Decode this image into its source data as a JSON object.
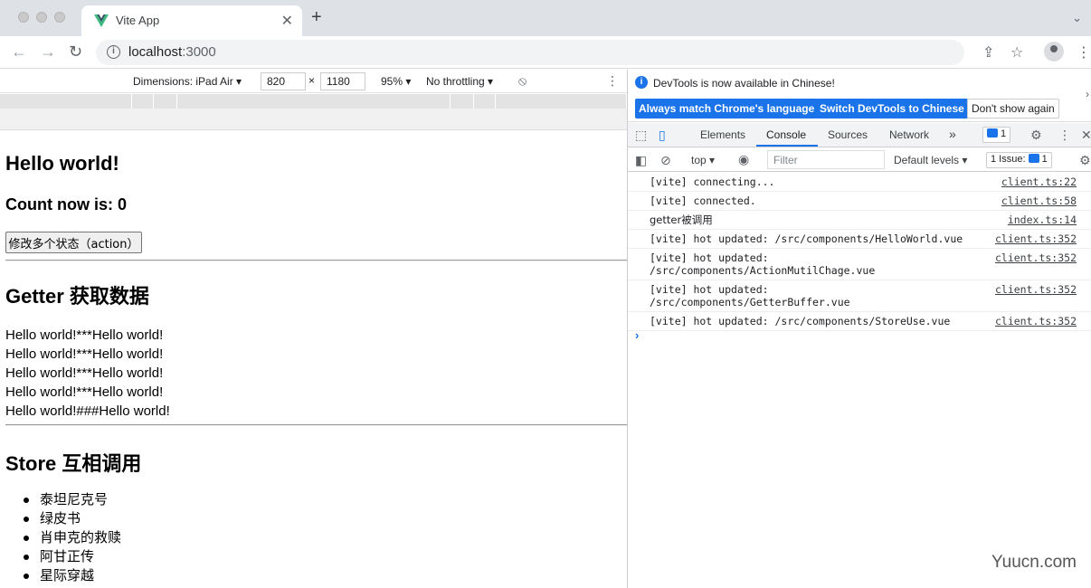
{
  "browser": {
    "tab_title": "Vite App",
    "url_host": "localhost",
    "url_port": ":3000"
  },
  "device_toolbar": {
    "dimensions_label": "Dimensions: iPad Air ▾",
    "width": "820",
    "times": "×",
    "height": "1180",
    "zoom": "95% ▾",
    "throttling": "No throttling ▾"
  },
  "page": {
    "hello_heading": "Hello world!",
    "count_text": "Count now is: 0",
    "action_button": "修改多个状态（action）",
    "getter_heading": "Getter 获取数据",
    "getter_lines": [
      "Hello world!***Hello world!",
      "Hello world!***Hello world!",
      "Hello world!***Hello world!",
      "Hello world!***Hello world!",
      "Hello world!###Hello world!"
    ],
    "store_heading": "Store 互相调用",
    "movies": [
      "泰坦尼克号",
      "绿皮书",
      "肖申克的救赎",
      "阿甘正传",
      "星际穿越"
    ]
  },
  "devtools": {
    "info_message": "DevTools is now available in Chinese!",
    "btn_match": "Always match Chrome's language",
    "btn_switch": "Switch DevTools to Chinese",
    "btn_dont_show": "Don't show again",
    "tabs": [
      "Elements",
      "Console",
      "Sources",
      "Network"
    ],
    "more_tabs": "»",
    "message_count": "1",
    "context": "top ▾",
    "filter_placeholder": "Filter",
    "levels": "Default levels ▾",
    "issues_label": "1 Issue:",
    "issues_count": "1",
    "logs": [
      {
        "message": "[vite] connecting...",
        "source": "client.ts:22"
      },
      {
        "message": "[vite] connected.",
        "source": "client.ts:58"
      },
      {
        "message": "getter被调用",
        "source": "index.ts:14"
      },
      {
        "message": "[vite] hot updated: /src/components/HelloWorld.vue",
        "source": "client.ts:352"
      },
      {
        "message": "[vite] hot updated:\n/src/components/ActionMutilChage.vue",
        "source": "client.ts:352"
      },
      {
        "message": "[vite] hot updated:\n/src/components/GetterBuffer.vue",
        "source": "client.ts:352"
      },
      {
        "message": "[vite] hot updated: /src/components/StoreUse.vue",
        "source": "client.ts:352"
      }
    ],
    "prompt": "›"
  },
  "watermark": "Yuucn.com",
  "colors": {
    "accent": "#1a73e8",
    "tabstrip": "#dee1e6"
  }
}
